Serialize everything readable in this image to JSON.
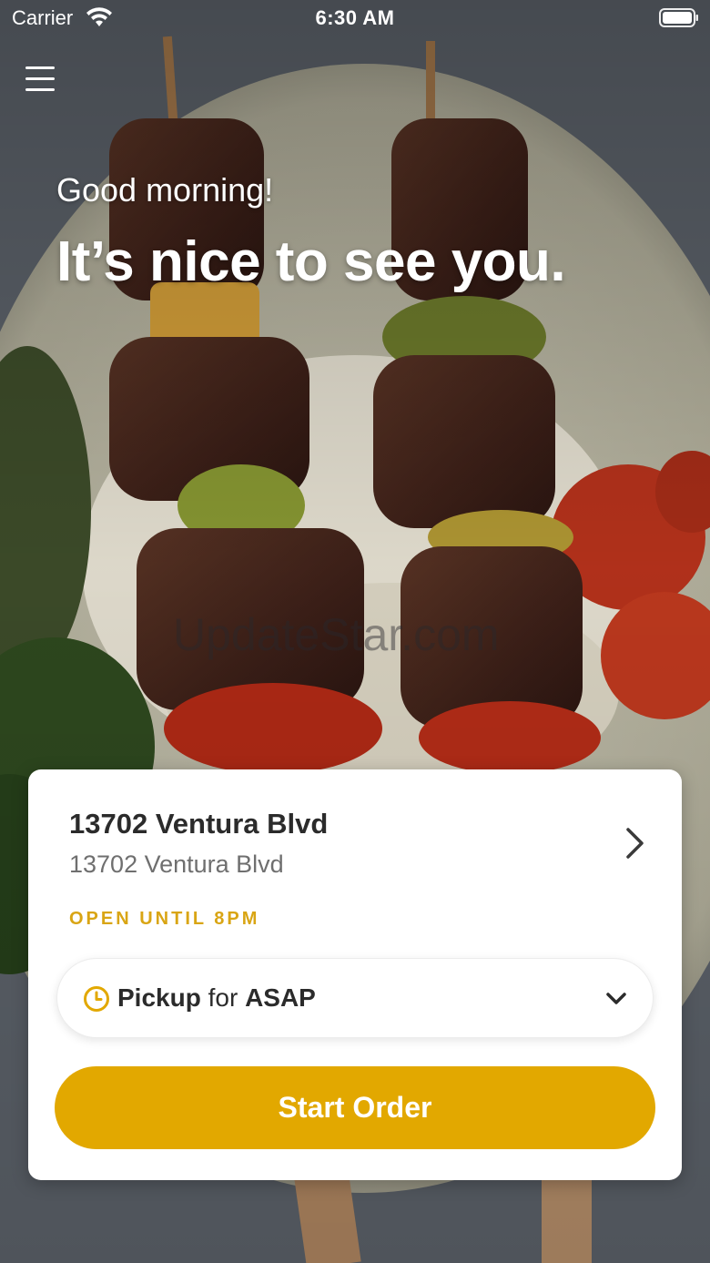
{
  "status_bar": {
    "carrier": "Carrier",
    "time": "6:30 AM"
  },
  "header": {
    "greeting": "Good morning!",
    "headline": "It’s nice to see you."
  },
  "watermark": "UpdateStar.com",
  "location_card": {
    "name": "13702 Ventura Blvd",
    "address": "13702 Ventura Blvd",
    "hours": "OPEN UNTIL 8PM",
    "order_type": {
      "mode": "Pickup",
      "connector": "for",
      "time": "ASAP"
    },
    "start_button": "Start Order"
  },
  "colors": {
    "accent": "#e2a800",
    "hours_text": "#d9a514",
    "card_bg": "#ffffff"
  },
  "icons": [
    "wifi-icon",
    "battery-icon",
    "menu-icon",
    "chevron-right-icon",
    "clock-icon",
    "chevron-down-icon"
  ]
}
